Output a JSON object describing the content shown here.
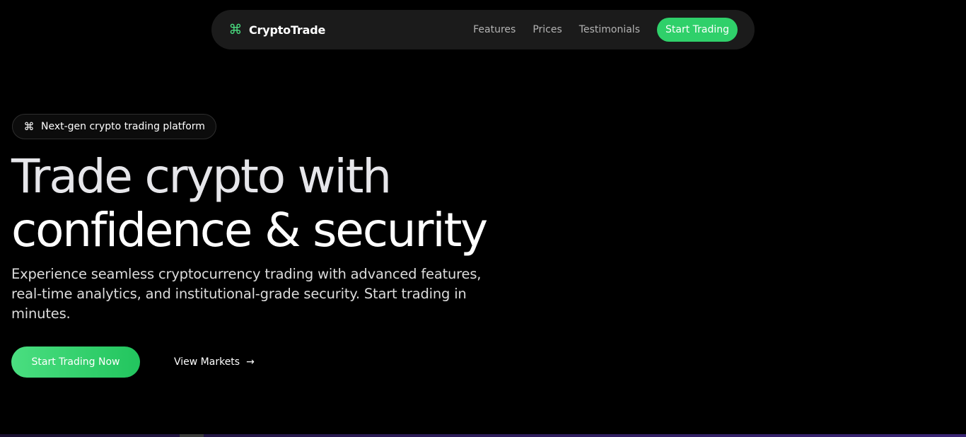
{
  "nav": {
    "brand": {
      "icon": "command-icon",
      "name": "CryptoTrade"
    },
    "links": [
      "Features",
      "Prices",
      "Testimonials"
    ],
    "cta_label": "Start Trading"
  },
  "hero": {
    "badge": {
      "icon": "command-icon",
      "text": "Next-gen crypto trading platform"
    },
    "title_line1": "Trade crypto with",
    "title_line2": "confidence & security",
    "description": "Experience seamless cryptocurrency trading with advanced features, real-time analytics, and institutional-grade security. Start trading in minutes.",
    "primary_cta": "Start Trading Now",
    "secondary_cta": "View Markets",
    "secondary_icon": "arrow-right-icon"
  },
  "colors": {
    "background": "#000000",
    "accent": "#22c55e",
    "accent_light": "#4ade80",
    "nav_bg": "#1b1b1b"
  }
}
